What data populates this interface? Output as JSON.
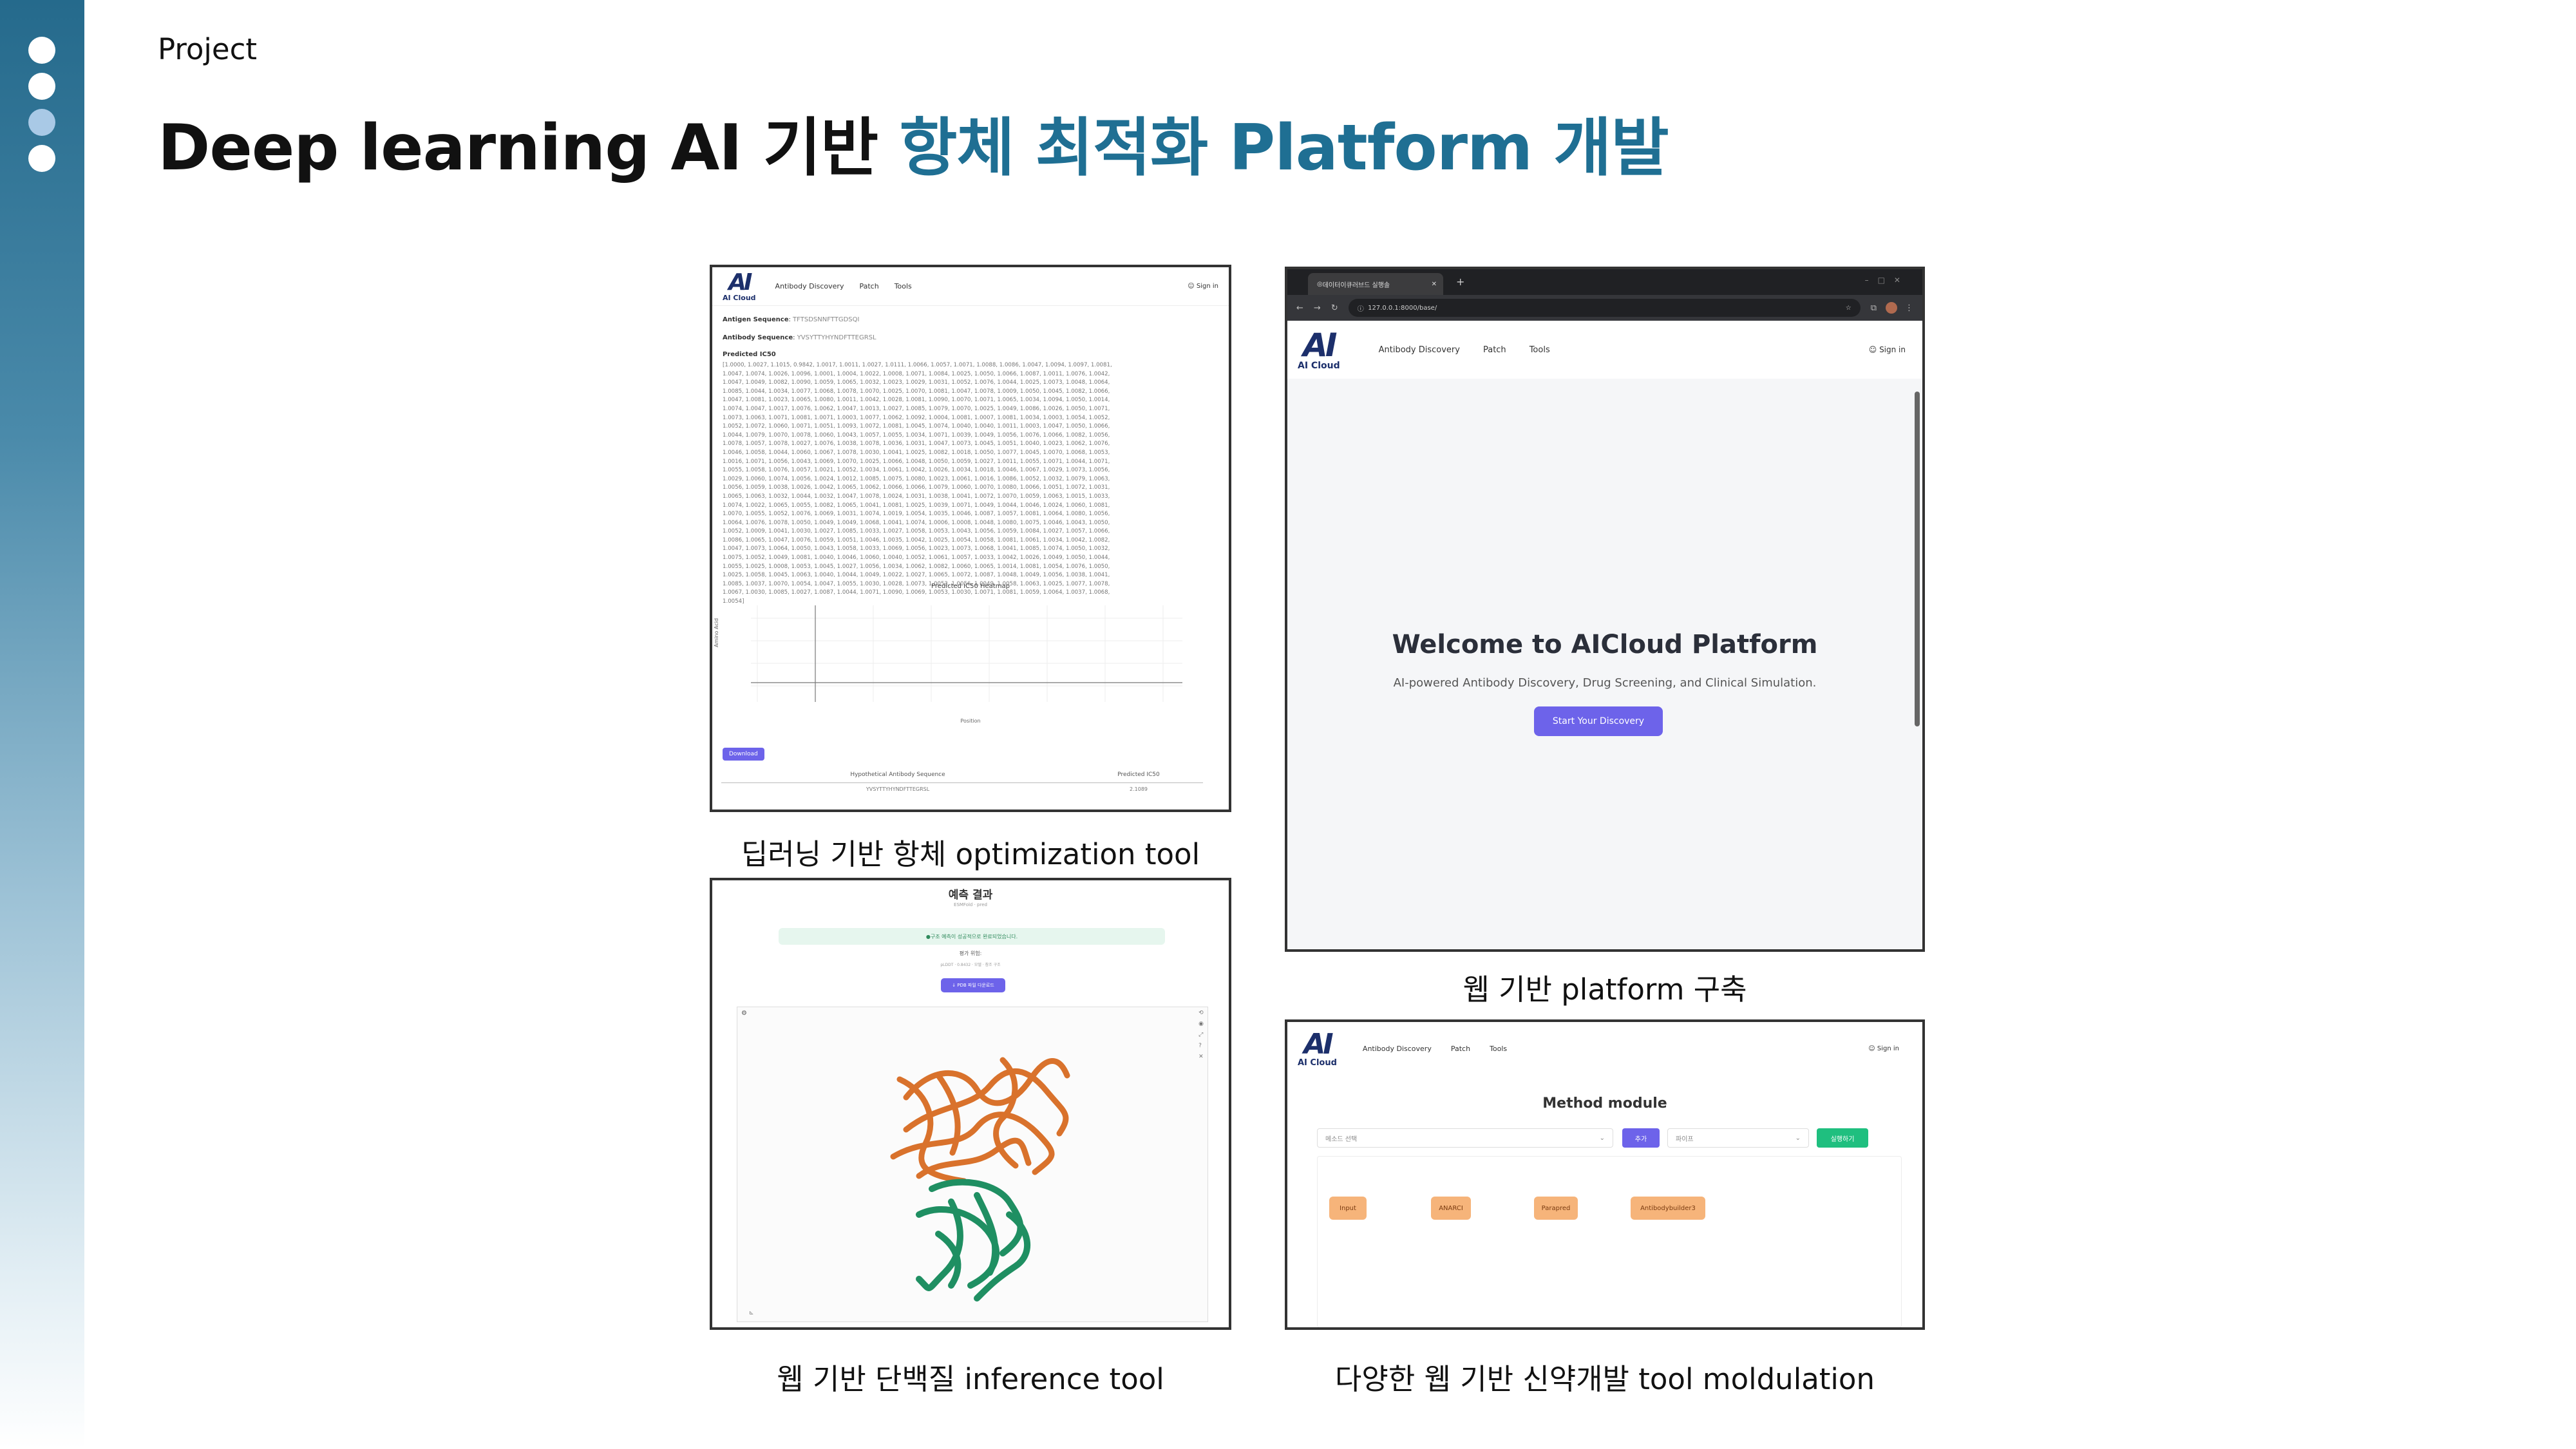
{
  "sidebar": {
    "dots": [
      "section-1",
      "section-2",
      "section-3",
      "section-4"
    ],
    "active_index": 2,
    "colors": {
      "top": "#256a8c",
      "bottom": "#ffffff",
      "dot": "#ffffff",
      "active_dot": "#a9c9e6"
    }
  },
  "header": {
    "section_label": "Project",
    "title_prefix": "Deep learning AI 기반 ",
    "title_accent": "항체 최적화 Platform 개발",
    "accent_color": "#1f6f93"
  },
  "captions": {
    "optimization_tool": "딥러닝 기반 항체 optimization tool",
    "web_platform": "웹 기반 platform 구축",
    "inference_tool": "웹 기반 단백질 inference tool",
    "modulation_tool": "다양한 웹 기반 신약개발 tool moldulation"
  },
  "app": {
    "logo_mark": "AI",
    "logo_text": "AI Cloud",
    "nav": [
      "Antibody Discovery",
      "Patch",
      "Tools"
    ],
    "signin": "Sign in"
  },
  "optimization_screen": {
    "antigen_label": "Antigen Sequence",
    "antigen_value": "TFTSDSNNFTTGDSQI",
    "antibody_label": "Antibody Sequence",
    "antibody_value": "YVSYTTYHYNDFTTEGRSL",
    "predicted_label": "Predicted IC50",
    "predicted_lines": [
      "[1.0000, 1.0027, 1.1015, 0.9842, 1.0017, 1.0011, 1.0027, 1.0111, 1.0066, 1.0057, 1.0071, 1.0088, 1.0086, 1.0047, 1.0094, 1.0097, 1.0081,",
      "1.0047, 1.0074, 1.0026, 1.0096, 1.0001, 1.0004, 1.0022, 1.0008, 1.0071, 1.0084, 1.0025, 1.0050, 1.0066, 1.0087, 1.0011, 1.0076, 1.0042,",
      "1.0047, 1.0049, 1.0082, 1.0090, 1.0059, 1.0065, 1.0032, 1.0023, 1.0029, 1.0031, 1.0052, 1.0076, 1.0044, 1.0025, 1.0073, 1.0048, 1.0064,",
      "1.0085, 1.0044, 1.0034, 1.0077, 1.0068, 1.0078, 1.0070, 1.0025, 1.0070, 1.0081, 1.0047, 1.0078, 1.0009, 1.0050, 1.0045, 1.0082, 1.0066,",
      "1.0047, 1.0081, 1.0023, 1.0065, 1.0080, 1.0011, 1.0042, 1.0028, 1.0081, 1.0090, 1.0070, 1.0071, 1.0065, 1.0034, 1.0094, 1.0050, 1.0014,",
      "1.0074, 1.0047, 1.0017, 1.0076, 1.0062, 1.0047, 1.0013, 1.0027, 1.0085, 1.0079, 1.0070, 1.0025, 1.0049, 1.0086, 1.0026, 1.0050, 1.0071,",
      "1.0073, 1.0063, 1.0071, 1.0081, 1.0071, 1.0003, 1.0077, 1.0062, 1.0092, 1.0004, 1.0081, 1.0007, 1.0081, 1.0034, 1.0003, 1.0054, 1.0052,",
      "1.0052, 1.0072, 1.0060, 1.0071, 1.0051, 1.0093, 1.0072, 1.0081, 1.0045, 1.0074, 1.0040, 1.0040, 1.0011, 1.0003, 1.0047, 1.0050, 1.0066,",
      "1.0044, 1.0079, 1.0070, 1.0078, 1.0060, 1.0043, 1.0057, 1.0055, 1.0034, 1.0071, 1.0039, 1.0049, 1.0056, 1.0076, 1.0066, 1.0082, 1.0056,",
      "1.0078, 1.0057, 1.0078, 1.0027, 1.0076, 1.0038, 1.0078, 1.0036, 1.0031, 1.0047, 1.0073, 1.0045, 1.0051, 1.0040, 1.0023, 1.0062, 1.0076,",
      "1.0046, 1.0058, 1.0044, 1.0060, 1.0067, 1.0078, 1.0030, 1.0041, 1.0025, 1.0082, 1.0018, 1.0050, 1.0077, 1.0045, 1.0070, 1.0068, 1.0053,",
      "1.0016, 1.0071, 1.0056, 1.0043, 1.0069, 1.0070, 1.0025, 1.0066, 1.0048, 1.0050, 1.0059, 1.0027, 1.0011, 1.0055, 1.0071, 1.0044, 1.0071,",
      "1.0055, 1.0058, 1.0076, 1.0057, 1.0021, 1.0052, 1.0034, 1.0061, 1.0042, 1.0026, 1.0034, 1.0018, 1.0046, 1.0067, 1.0029, 1.0073, 1.0056,",
      "1.0029, 1.0060, 1.0074, 1.0056, 1.0024, 1.0012, 1.0085, 1.0075, 1.0080, 1.0023, 1.0061, 1.0016, 1.0086, 1.0052, 1.0032, 1.0079, 1.0063,",
      "1.0056, 1.0059, 1.0038, 1.0026, 1.0042, 1.0065, 1.0062, 1.0066, 1.0066, 1.0079, 1.0060, 1.0070, 1.0080, 1.0066, 1.0051, 1.0072, 1.0031,",
      "1.0065, 1.0063, 1.0032, 1.0044, 1.0032, 1.0047, 1.0078, 1.0024, 1.0031, 1.0038, 1.0041, 1.0072, 1.0070, 1.0059, 1.0063, 1.0015, 1.0033,",
      "1.0074, 1.0022, 1.0065, 1.0055, 1.0082, 1.0065, 1.0041, 1.0081, 1.0025, 1.0039, 1.0071, 1.0049, 1.0044, 1.0046, 1.0024, 1.0060, 1.0081,",
      "1.0070, 1.0055, 1.0052, 1.0076, 1.0069, 1.0031, 1.0074, 1.0019, 1.0054, 1.0035, 1.0046, 1.0087, 1.0057, 1.0081, 1.0064, 1.0080, 1.0056,",
      "1.0064, 1.0076, 1.0078, 1.0050, 1.0049, 1.0049, 1.0068, 1.0041, 1.0074, 1.0006, 1.0008, 1.0048, 1.0080, 1.0075, 1.0046, 1.0043, 1.0050,",
      "1.0052, 1.0009, 1.0041, 1.0030, 1.0027, 1.0085, 1.0033, 1.0027, 1.0058, 1.0053, 1.0043, 1.0056, 1.0059, 1.0084, 1.0027, 1.0057, 1.0066,",
      "1.0086, 1.0065, 1.0047, 1.0076, 1.0059, 1.0051, 1.0046, 1.0035, 1.0042, 1.0025, 1.0054, 1.0058, 1.0081, 1.0061, 1.0034, 1.0042, 1.0082,",
      "1.0047, 1.0073, 1.0064, 1.0050, 1.0043, 1.0058, 1.0033, 1.0069, 1.0056, 1.0023, 1.0073, 1.0068, 1.0041, 1.0085, 1.0074, 1.0050, 1.0032,",
      "1.0075, 1.0052, 1.0049, 1.0081, 1.0040, 1.0046, 1.0060, 1.0040, 1.0052, 1.0061, 1.0057, 1.0033, 1.0042, 1.0026, 1.0049, 1.0050, 1.0044,",
      "1.0055, 1.0025, 1.0008, 1.0053, 1.0045, 1.0027, 1.0056, 1.0034, 1.0062, 1.0082, 1.0060, 1.0065, 1.0014, 1.0081, 1.0054, 1.0076, 1.0050,",
      "1.0025, 1.0058, 1.0045, 1.0063, 1.0040, 1.0044, 1.0049, 1.0022, 1.0027, 1.0065, 1.0072, 1.0087, 1.0048, 1.0049, 1.0056, 1.0038, 1.0041,",
      "1.0085, 1.0037, 1.0070, 1.0054, 1.0047, 1.0055, 1.0030, 1.0028, 1.0073, 1.0053, 1.0056, 1.0049, 1.0058, 1.0063, 1.0025, 1.0077, 1.0078,",
      "1.0067, 1.0030, 1.0085, 1.0027, 1.0087, 1.0044, 1.0071, 1.0090, 1.0069, 1.0053, 1.0030, 1.0071, 1.0081, 1.0059, 1.0064, 1.0037, 1.0068,",
      "1.0054]"
    ],
    "heatmap_title": "Predicted IC50 Heatmap",
    "heatmap_xlabel": "Position",
    "heatmap_ylabel": "Amino Acid",
    "download_label": "Download",
    "table_headers": [
      "Hypothetical Antibody Sequence",
      "Predicted IC50"
    ],
    "table_row": [
      "YVSYTTYHYNDFTTEGRSL",
      "2.1089"
    ]
  },
  "browser": {
    "tab_title": "데이터이큐러브드 실행솔",
    "new_tab": "+",
    "url": "127.0.0.1:8000/base/",
    "welcome_title": "Welcome to AICloud Platform",
    "welcome_subtitle": "AI-powered Antibody Discovery, Drug Screening, and Clinical Simulation.",
    "cta": "Start Your Discovery",
    "accent": "#6d63ea"
  },
  "inference_screen": {
    "title": "예측 결과",
    "subtitle": "ESMFold · pred",
    "banner": "구조 예측이 성공적으로 완료되었습니다.",
    "label": "평가 위험:",
    "sub": "pLDDT · 0.8432 · 모델 · 참조 구조",
    "button": "↓ PDB 파일 다운로드",
    "colors": {
      "chain_a": "#d9722c",
      "chain_b": "#1f8f62"
    }
  },
  "module_screen": {
    "title": "Method module",
    "select_placeholder": "메소드 선택",
    "add_button": "추가",
    "template_placeholder": "파이프",
    "run_button": "실행하기",
    "nodes": [
      "Input",
      "ANARCI",
      "Parapred",
      "Antibodybuilder3"
    ],
    "colors": {
      "node": "#f6b47a",
      "add": "#6d63ea",
      "run": "#1fbf7f"
    }
  }
}
